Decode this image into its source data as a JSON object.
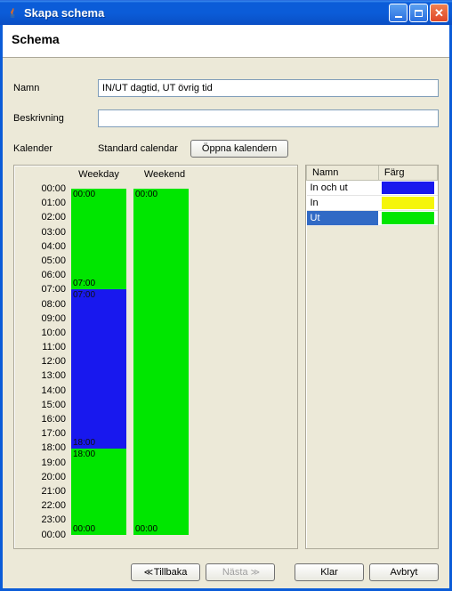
{
  "window": {
    "title": "Skapa schema"
  },
  "header": {
    "title": "Schema"
  },
  "form": {
    "name_label": "Namn",
    "name_value": "IN/UT dagtid, UT övrig tid",
    "desc_label": "Beskrivning",
    "desc_value": "",
    "calendar_label": "Kalender",
    "calendar_value": "Standard calendar",
    "open_calendar_button": "Öppna kalendern"
  },
  "schedule": {
    "headers": {
      "weekday": "Weekday",
      "weekend": "Weekend"
    },
    "hours": [
      "00:00",
      "01:00",
      "02:00",
      "03:00",
      "04:00",
      "05:00",
      "06:00",
      "07:00",
      "08:00",
      "09:00",
      "10:00",
      "11:00",
      "12:00",
      "13:00",
      "14:00",
      "15:00",
      "16:00",
      "17:00",
      "18:00",
      "19:00",
      "20:00",
      "21:00",
      "22:00",
      "23:00",
      "00:00"
    ],
    "weekday_blocks": {
      "b0": {
        "start": "00:00",
        "end": "07:00",
        "color": "green"
      },
      "b1": {
        "start": "07:00",
        "end": "18:00",
        "color": "blue"
      },
      "b2": {
        "start": "18:00",
        "end": "00:00",
        "color": "green"
      }
    },
    "weekend_blocks": {
      "b0": {
        "start": "00:00",
        "end": "00:00",
        "color": "green"
      }
    }
  },
  "legend": {
    "name_header": "Namn",
    "color_header": "Färg",
    "rows": {
      "r0": {
        "name": "In och ut",
        "color": "#1818ee",
        "selected": false
      },
      "r1": {
        "name": "In",
        "color": "#f5f50a",
        "selected": false
      },
      "r2": {
        "name": "Ut",
        "color": "#00e600",
        "selected": true
      }
    }
  },
  "footer": {
    "back": "Tillbaka",
    "next": "Nästa",
    "finish": "Klar",
    "cancel": "Avbryt"
  }
}
